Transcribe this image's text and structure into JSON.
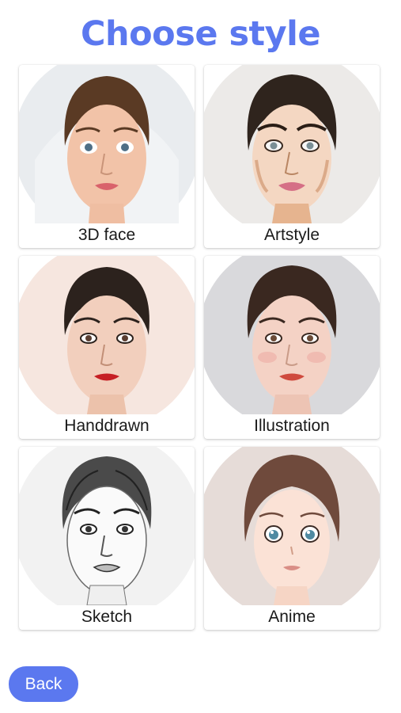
{
  "page": {
    "title": "Choose style",
    "accent_color": "#5b78ef"
  },
  "styles": [
    {
      "label": "3D face",
      "icon": "3d-face-portrait"
    },
    {
      "label": "Artstyle",
      "icon": "artstyle-portrait"
    },
    {
      "label": "Handdrawn",
      "icon": "handdrawn-portrait"
    },
    {
      "label": "Illustration",
      "icon": "illustration-portrait"
    },
    {
      "label": "Sketch",
      "icon": "sketch-portrait"
    },
    {
      "label": "Anime",
      "icon": "anime-portrait"
    }
  ],
  "footer": {
    "back_label": "Back"
  }
}
